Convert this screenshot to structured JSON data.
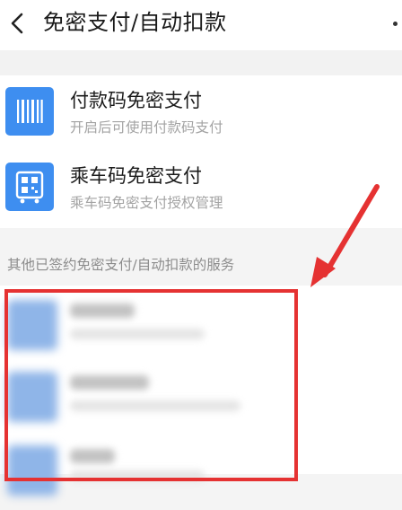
{
  "header": {
    "title": "免密支付/自动扣款"
  },
  "items": [
    {
      "title": "付款码免密支付",
      "subtitle": "开启后可使用付款码支付",
      "icon": "barcode-icon"
    },
    {
      "title": "乘车码免密支付",
      "subtitle": "乘车码免密支付授权管理",
      "icon": "bus-qr-icon"
    }
  ],
  "section": {
    "label": "其他已签约免密支付/自动扣款的服务"
  },
  "colors": {
    "accent": "#3e8ef0",
    "annotation": "#e53232"
  }
}
